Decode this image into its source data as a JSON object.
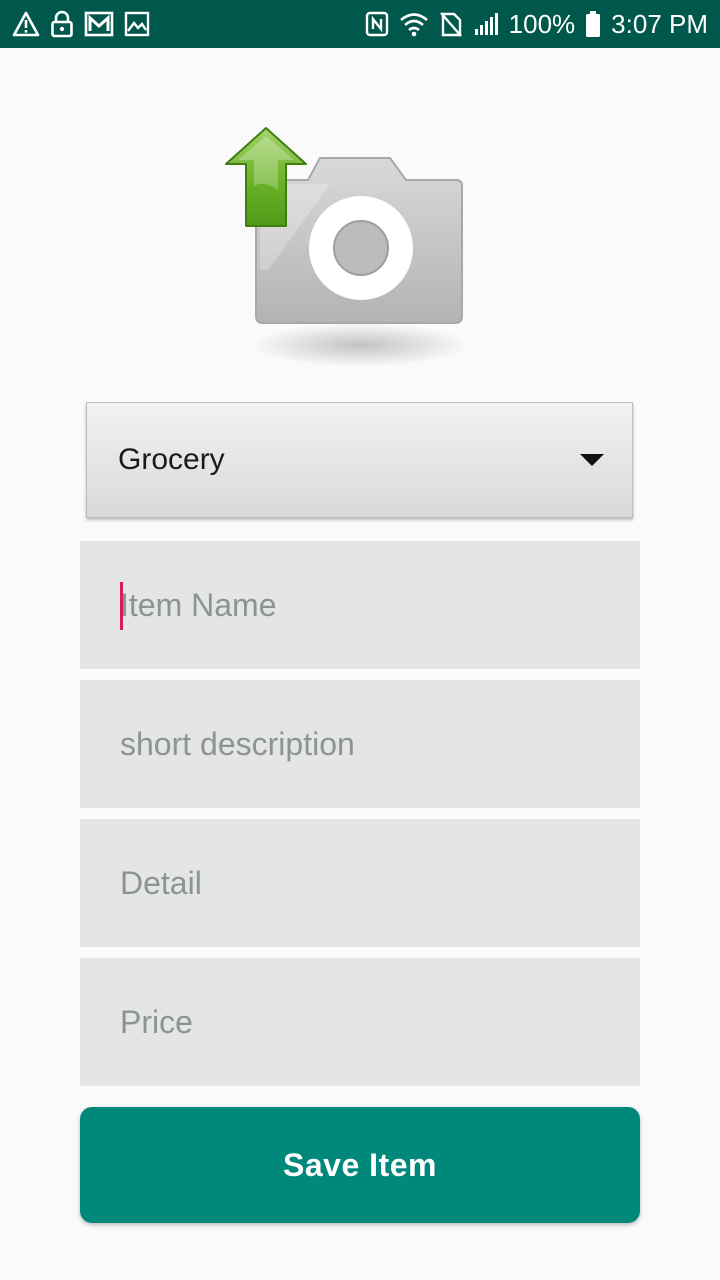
{
  "status_bar": {
    "left_icons": [
      "warning-icon",
      "lock-icon",
      "gmail-icon",
      "image-icon"
    ],
    "right_icons": [
      "nfc-icon",
      "wifi-icon",
      "no-sim-icon",
      "signal-icon",
      "battery-icon"
    ],
    "battery": "100%",
    "time": "3:07 PM",
    "background_color": "#00574b"
  },
  "photo": {
    "icon": "camera-upload-icon"
  },
  "category": {
    "selected": "Grocery"
  },
  "form": {
    "item_name_placeholder": "Item Name",
    "short_description_placeholder": "short description",
    "detail_placeholder": "Detail",
    "price_placeholder": "Price"
  },
  "save_button": {
    "label": "Save Item",
    "color": "#00887a"
  },
  "colors": {
    "field_background": "#e3e6e5",
    "caret": "#d81b60"
  }
}
